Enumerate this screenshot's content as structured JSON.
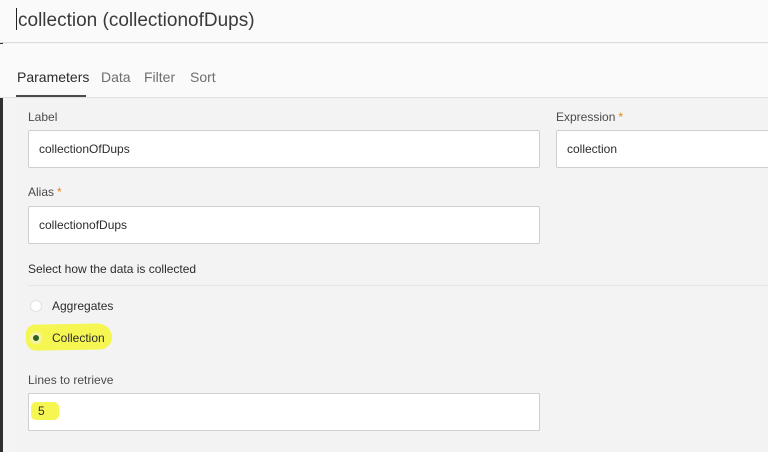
{
  "window": {
    "title": "collection (collectionofDups)"
  },
  "tabs": [
    {
      "label": "Parameters",
      "active": true
    },
    {
      "label": "Data",
      "active": false
    },
    {
      "label": "Filter",
      "active": false
    },
    {
      "label": "Sort",
      "active": false
    }
  ],
  "form": {
    "label": {
      "label": "Label",
      "value": "collectionOfDups"
    },
    "expression": {
      "label": "Expression",
      "required_mark": "*",
      "value": "collection"
    },
    "alias": {
      "label": "Alias",
      "required_mark": "*",
      "value": "collectionofDups"
    },
    "collection_mode": {
      "label": "Select how the data is collected",
      "options": [
        {
          "label": "Aggregates",
          "selected": false
        },
        {
          "label": "Collection",
          "selected": true
        }
      ]
    },
    "lines": {
      "label": "Lines to retrieve",
      "value": "5"
    }
  },
  "colors": {
    "highlight": "#f6f652",
    "required": "#e68619",
    "radio_selected": "#2f5e1f"
  }
}
